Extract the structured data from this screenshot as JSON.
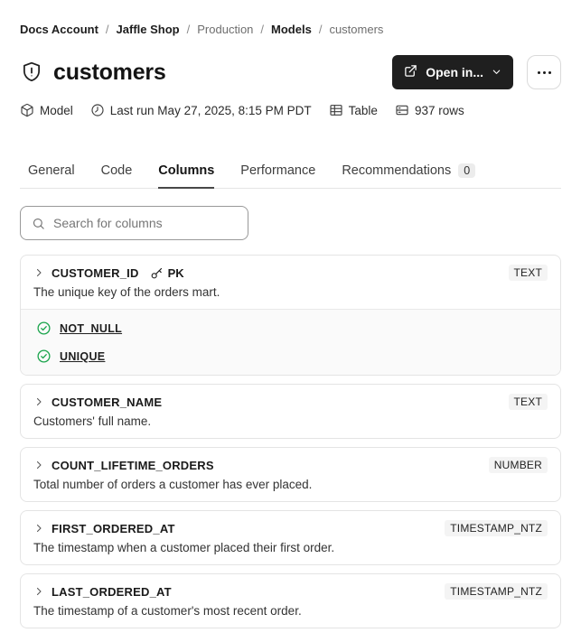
{
  "breadcrumb": {
    "separator": "/",
    "items": [
      {
        "label": "Docs Account",
        "emphasis": true
      },
      {
        "label": "Jaffle Shop",
        "emphasis": true
      },
      {
        "label": "Production",
        "emphasis": false
      },
      {
        "label": "Models",
        "emphasis": true
      },
      {
        "label": "customers",
        "emphasis": false
      }
    ]
  },
  "header": {
    "title": "customers",
    "open_in_label": "Open in...",
    "more_button": "ellipsis"
  },
  "meta": {
    "items": [
      {
        "icon": "cube-icon",
        "label": "Model"
      },
      {
        "icon": "clock-icon",
        "label": "Last run May 27, 2025, 8:15 PM PDT"
      },
      {
        "icon": "table-icon",
        "label": "Table"
      },
      {
        "icon": "rows-icon",
        "label": "937 rows"
      }
    ]
  },
  "tabs": {
    "items": [
      {
        "label": "General",
        "active": false
      },
      {
        "label": "Code",
        "active": false
      },
      {
        "label": "Columns",
        "active": true
      },
      {
        "label": "Performance",
        "active": false
      },
      {
        "label": "Recommendations",
        "active": false,
        "badge": "0"
      }
    ]
  },
  "search": {
    "placeholder": "Search for columns",
    "value": ""
  },
  "columns": [
    {
      "name": "CUSTOMER_ID",
      "pk_label": "PK",
      "type": "TEXT",
      "description": "The unique key of the orders mart.",
      "tests": [
        "NOT_NULL",
        "UNIQUE"
      ]
    },
    {
      "name": "CUSTOMER_NAME",
      "type": "TEXT",
      "description": "Customers' full name."
    },
    {
      "name": "COUNT_LIFETIME_ORDERS",
      "type": "NUMBER",
      "description": "Total number of orders a customer has ever placed."
    },
    {
      "name": "FIRST_ORDERED_AT",
      "type": "TIMESTAMP_NTZ",
      "description": "The timestamp when a customer placed their first order."
    },
    {
      "name": "LAST_ORDERED_AT",
      "type": "TIMESTAMP_NTZ",
      "description": "The timestamp of a customer's most recent order."
    }
  ],
  "icons": {
    "shield-exclamation-icon": "shield with !",
    "external-link-icon": "arrow out of box",
    "chevron-down-icon": "v",
    "ellipsis-icon": "...",
    "cube-icon": "3d box",
    "clock-icon": "clock",
    "table-icon": "grid table",
    "rows-icon": "stacked rows",
    "search-icon": "magnifier",
    "chevron-right-icon": ">",
    "key-icon": "key",
    "check-circle-icon": "check in circle"
  },
  "colors": {
    "button_dark": "#1f1f1f",
    "test_green": "#18a34a",
    "badge_bg": "#f4f4f4",
    "card_border": "#e4e4e4",
    "muted_text": "#6e6e6e"
  }
}
